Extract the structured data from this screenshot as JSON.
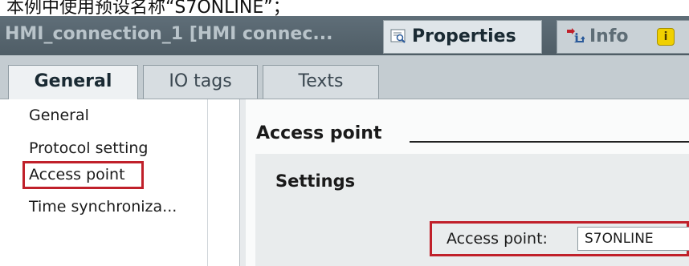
{
  "caption": {
    "text": "本例中使用预设名称“S7ONLINE”；"
  },
  "header": {
    "connection_title": "HMI_connection_1 [HMI connec...",
    "tabs": [
      {
        "label": "Properties",
        "icon": "properties-icon",
        "active": true
      },
      {
        "label": "Info",
        "icon": "info-icon",
        "active": false
      }
    ]
  },
  "subtabs": [
    {
      "label": "General",
      "active": true
    },
    {
      "label": "IO tags",
      "active": false
    },
    {
      "label": "Texts",
      "active": false
    }
  ],
  "sidebar": {
    "items": [
      {
        "label": "General"
      },
      {
        "label": "Protocol setting"
      },
      {
        "label": "Access point",
        "selected": true
      },
      {
        "label": "Time synchroniza..."
      }
    ]
  },
  "main": {
    "section_title": "Access point",
    "settings_title": "Settings",
    "access_point_label": "Access point:",
    "access_point_value": "S7ONLINE"
  },
  "colors": {
    "highlight": "#c0202a",
    "header_bg": "#56646d",
    "warning": "#f0d000"
  }
}
